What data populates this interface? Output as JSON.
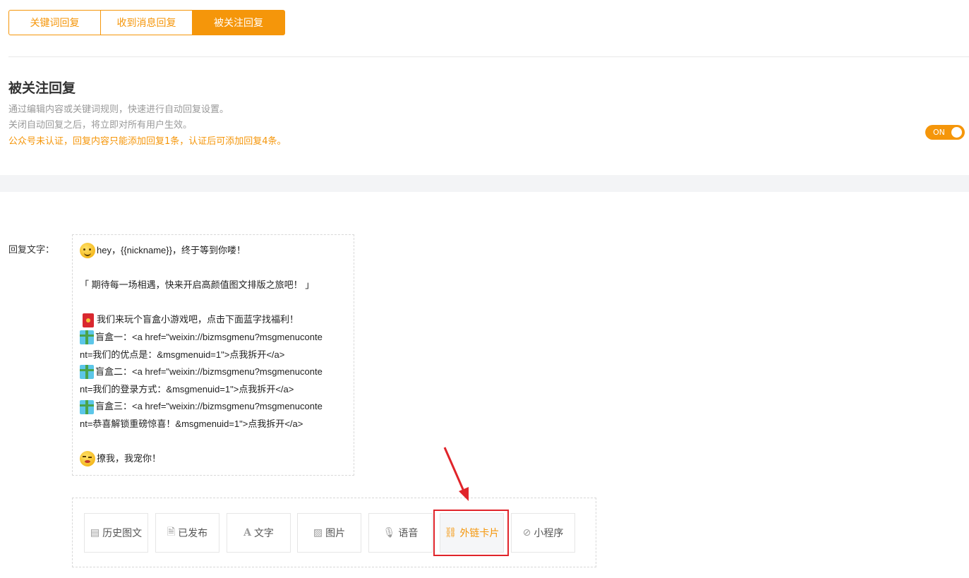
{
  "tabs": [
    {
      "label": "关键词回复",
      "active": false
    },
    {
      "label": "收到消息回复",
      "active": false
    },
    {
      "label": "被关注回复",
      "active": true
    }
  ],
  "section": {
    "title": "被关注回复",
    "desc1": "通过编辑内容或关键词规则，快速进行自动回复设置。",
    "desc2": "关闭自动回复之后，将立即对所有用户生效。",
    "warning": "公众号未认证，回复内容只能添加回复1条，认证后可添加回复4条。"
  },
  "toggle": {
    "label": "ON",
    "state": "on"
  },
  "reply": {
    "label": "回复文字：",
    "lines": [
      "hey，{{nickname}}，终于等到你喽！",
      "",
      "「 期待每一场相遇，快来开启高颜值图文排版之旅吧！ 」",
      "",
      "我们来玩个盲盒小游戏吧，点击下面蓝字找福利！",
      "盲盒一：<a href=\"weixin://bizmsgmenu?msgmenuconte",
      "nt=我们的优点是：&msgmenuid=1\">点我拆开</a>",
      "盲盒二：<a href=\"weixin://bizmsgmenu?msgmenuconte",
      "nt=我们的登录方式：&msgmenuid=1\">点我拆开</a>",
      "盲盒三：<a href=\"weixin://bizmsgmenu?msgmenuconte",
      "nt=恭喜解锁重磅惊喜！&msgmenuid=1\">点我拆开</a>",
      "",
      "撩我，我宠你！"
    ]
  },
  "toolbar": {
    "items": [
      {
        "label": "历史图文",
        "icon": "newspaper-icon",
        "glyph": "▤"
      },
      {
        "label": "已发布",
        "icon": "document-icon",
        "glyph": "🗎"
      },
      {
        "label": "文字",
        "icon": "text-icon",
        "glyph": "A"
      },
      {
        "label": "图片",
        "icon": "image-icon",
        "glyph": "▨"
      },
      {
        "label": "语音",
        "icon": "microphone-icon",
        "glyph": "🎙"
      },
      {
        "label": "外链卡片",
        "icon": "link-icon",
        "glyph": "⛓",
        "active": true
      },
      {
        "label": "小程序",
        "icon": "mini-program-icon",
        "glyph": "⊘"
      }
    ]
  },
  "colors": {
    "accent": "#f5960a",
    "highlight": "#e0242a",
    "annotation_arrow": "#e0242a"
  }
}
